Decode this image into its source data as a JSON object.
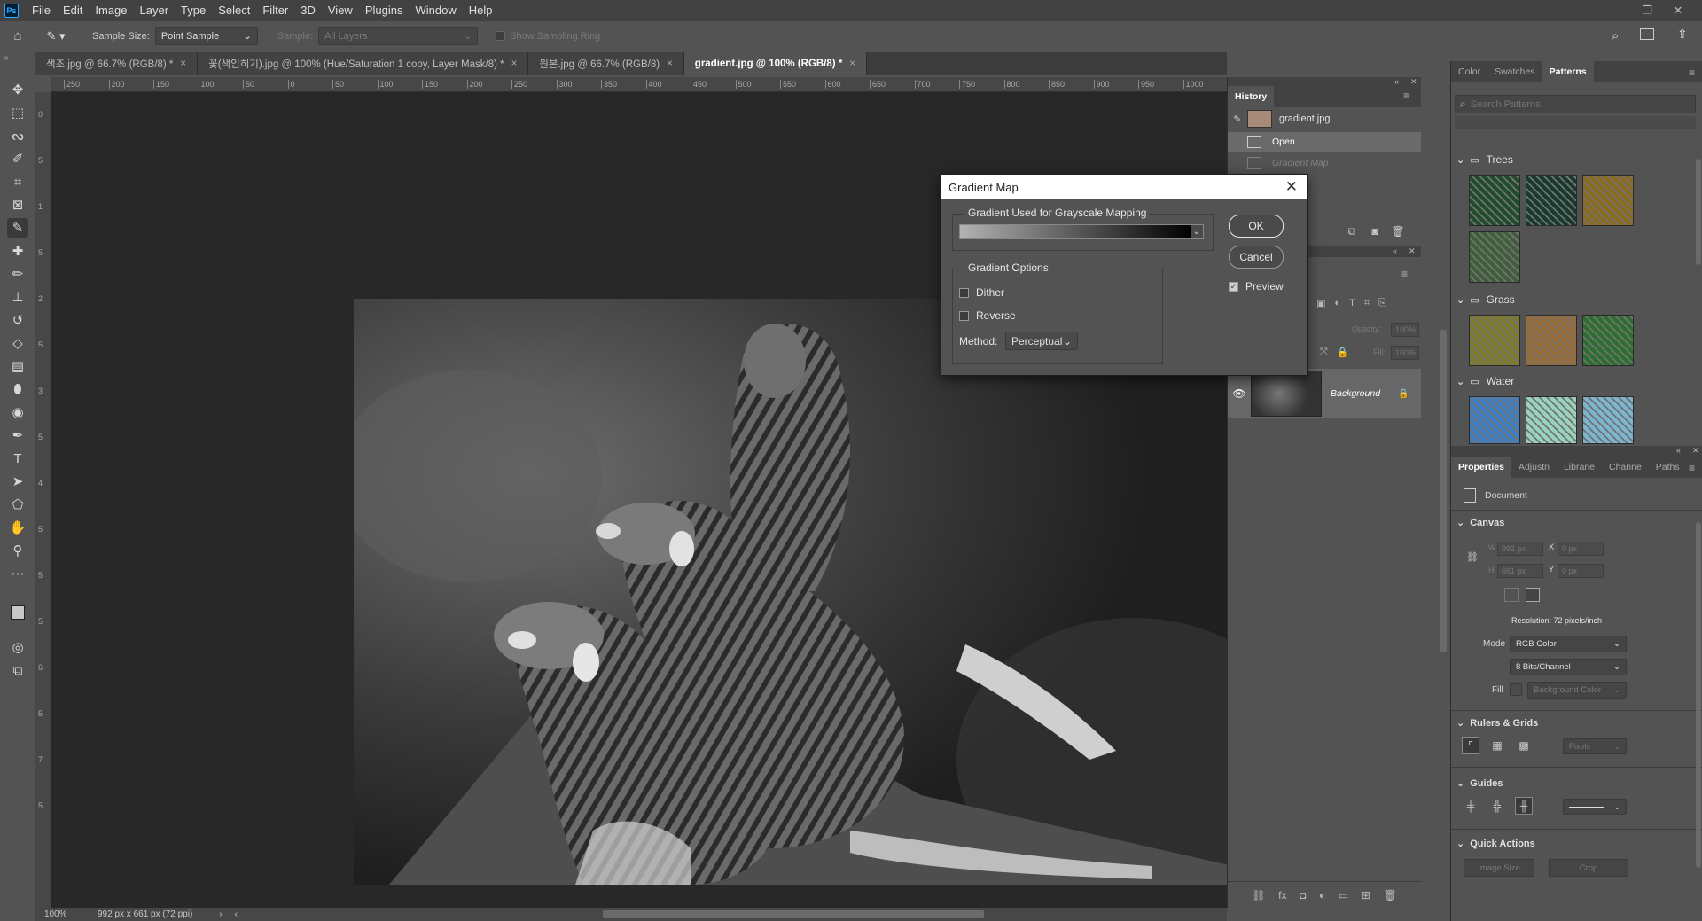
{
  "app": {
    "logo": "Ps"
  },
  "menu": [
    "File",
    "Edit",
    "Image",
    "Layer",
    "Type",
    "Select",
    "Filter",
    "3D",
    "View",
    "Plugins",
    "Window",
    "Help"
  ],
  "options": {
    "sample_size_label": "Sample Size:",
    "sample_size_value": "Point Sample",
    "sample_label": "Sample:",
    "sample_value": "All Layers",
    "show_ring_label": "Show Sampling Ring"
  },
  "tabs": [
    {
      "label": "색조.jpg @ 66.7% (RGB/8) *"
    },
    {
      "label": "꽃(색입히기).jpg @ 100% (Hue/Saturation 1 copy, Layer Mask/8) *"
    },
    {
      "label": "원본.jpg @ 66.7% (RGB/8)"
    },
    {
      "label": "gradient.jpg @ 100% (RGB/8) *"
    }
  ],
  "ruler_top": [
    "250",
    "200",
    "150",
    "100",
    "50",
    "0",
    "50",
    "100",
    "150",
    "200",
    "250",
    "300",
    "350",
    "400",
    "450",
    "500",
    "550",
    "600",
    "650",
    "700",
    "750",
    "800",
    "850",
    "900",
    "950",
    "1000"
  ],
  "ruler_left": [
    "0",
    "5",
    "1",
    "5",
    "2",
    "5",
    "3",
    "5",
    "4",
    "5",
    "5",
    "5",
    "6",
    "5",
    "7",
    "5"
  ],
  "status": {
    "zoom": "100%",
    "doc_info": "992 px x 661 px (72 ppi)"
  },
  "history": {
    "title": "History",
    "snapshot": "gradient.jpg",
    "items": [
      "Open",
      "Gradient Map"
    ]
  },
  "dialog": {
    "title": "Gradient Map",
    "gradient_group": "Gradient Used for Grayscale Mapping",
    "options_group": "Gradient Options",
    "dither": "Dither",
    "reverse": "Reverse",
    "method_label": "Method:",
    "method_value": "Perceptual",
    "ok": "OK",
    "cancel": "Cancel",
    "preview": "Preview",
    "preview_checked": true
  },
  "layers": {
    "opacity_label": "Opacity:",
    "opacity_value": "100%",
    "fill_label": "Fill:",
    "fill_value": "100%",
    "background_layer": "Background"
  },
  "patterns_panel": {
    "tabs": [
      "Color",
      "Swatches",
      "Patterns"
    ],
    "search_placeholder": "Search Patterns",
    "groups": [
      {
        "name": "Trees",
        "swatches": [
          "#1f4d2a",
          "#183a2c",
          "#8c6b1e",
          "#3f5f3a"
        ]
      },
      {
        "name": "Grass",
        "swatches": [
          "#7f7a25",
          "#9c6b33",
          "#2c6e2e"
        ]
      },
      {
        "name": "Water",
        "swatches": [
          "#3d7fc6",
          "#9ad3bd",
          "#7db5cf"
        ]
      }
    ]
  },
  "properties": {
    "tabs": [
      "Properties",
      "Adjustn",
      "Librarie",
      "Channe",
      "Paths"
    ],
    "doc_label": "Document",
    "canvas": "Canvas",
    "w_label": "W",
    "w_value": "992 px",
    "h_label": "H",
    "h_value": "661 px",
    "x_label": "X",
    "x_value": "0 px",
    "y_label": "Y",
    "y_value": "0 px",
    "resolution": "Resolution: 72 pixels/inch",
    "mode_label": "Mode",
    "mode_value": "RGB Color",
    "bits_value": "8 Bits/Channel",
    "fill_label": "Fill",
    "fill_value": "Background Color",
    "rulers_grids": "Rulers & Grids",
    "units_value": "Pixels",
    "guides": "Guides",
    "quick_actions": "Quick Actions",
    "image_size_btn": "Image Size",
    "crop_btn": "Crop"
  }
}
